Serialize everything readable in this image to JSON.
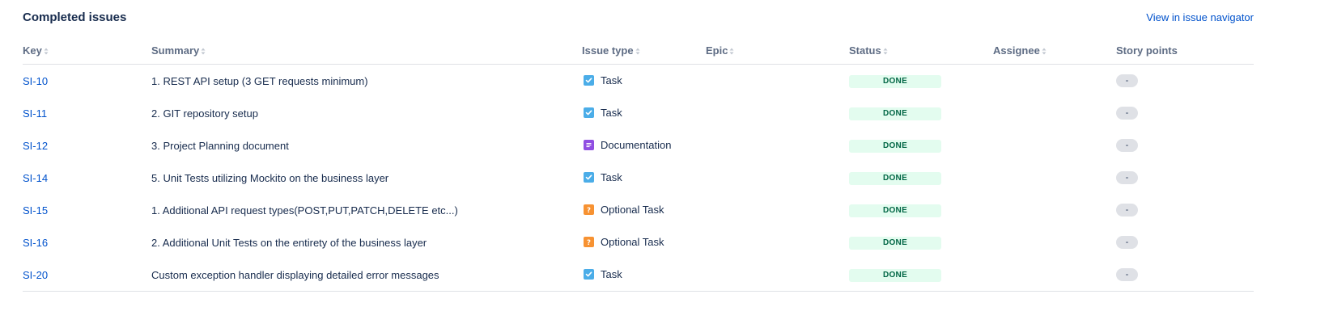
{
  "panel": {
    "title": "Completed issues",
    "nav_link": "View in issue navigator"
  },
  "columns": {
    "key": "Key",
    "summary": "Summary",
    "issue_type": "Issue type",
    "epic": "Epic",
    "status": "Status",
    "assignee": "Assignee",
    "story_points": "Story points"
  },
  "issue_types": {
    "task": {
      "icon": "checkbox-task-icon",
      "color": "#4bade8"
    },
    "documentation": {
      "icon": "documentation-icon",
      "color": "#904ee2"
    },
    "optional_task": {
      "icon": "question-mark-icon",
      "color": "#f79232"
    }
  },
  "rows": [
    {
      "key": "SI-10",
      "summary": "1. REST API setup (3 GET requests minimum)",
      "type": "Task",
      "type_kind": "task",
      "epic": "",
      "status": "DONE",
      "assignee": "",
      "points": "-"
    },
    {
      "key": "SI-11",
      "summary": "2. GIT repository setup",
      "type": "Task",
      "type_kind": "task",
      "epic": "",
      "status": "DONE",
      "assignee": "",
      "points": "-"
    },
    {
      "key": "SI-12",
      "summary": "3. Project Planning document",
      "type": "Documentation",
      "type_kind": "documentation",
      "epic": "",
      "status": "DONE",
      "assignee": "",
      "points": "-"
    },
    {
      "key": "SI-14",
      "summary": "5. Unit Tests utilizing Mockito on the business layer",
      "type": "Task",
      "type_kind": "task",
      "epic": "",
      "status": "DONE",
      "assignee": "",
      "points": "-"
    },
    {
      "key": "SI-15",
      "summary": "1. Additional API request types(POST,PUT,PATCH,DELETE etc...)",
      "type": "Optional Task",
      "type_kind": "optional_task",
      "epic": "",
      "status": "DONE",
      "assignee": "",
      "points": "-"
    },
    {
      "key": "SI-16",
      "summary": "2. Additional Unit Tests on the entirety of the business layer",
      "type": "Optional Task",
      "type_kind": "optional_task",
      "epic": "",
      "status": "DONE",
      "assignee": "",
      "points": "-"
    },
    {
      "key": "SI-20",
      "summary": "Custom exception handler displaying detailed error messages",
      "type": "Task",
      "type_kind": "task",
      "epic": "",
      "status": "DONE",
      "assignee": "",
      "points": "-"
    }
  ],
  "colors": {
    "link": "#0052cc",
    "status_bg": "#e3fcef",
    "status_text": "#006644"
  }
}
